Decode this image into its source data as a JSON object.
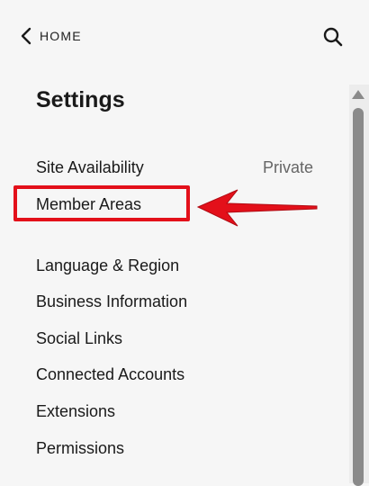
{
  "header": {
    "back_label": "HOME",
    "back_icon": "chevron-left-icon",
    "search_icon": "search-icon"
  },
  "page_title": "Settings",
  "items": [
    {
      "label": "Site Availability",
      "value": "Private"
    },
    {
      "label": "Member Areas"
    },
    {
      "label": "Language & Region"
    },
    {
      "label": "Business Information"
    },
    {
      "label": "Social Links"
    },
    {
      "label": "Connected Accounts"
    },
    {
      "label": "Extensions"
    },
    {
      "label": "Permissions"
    }
  ],
  "annotation": {
    "highlighted_item": "Member Areas",
    "color": "#e3101a",
    "arrow_direction": "left"
  }
}
